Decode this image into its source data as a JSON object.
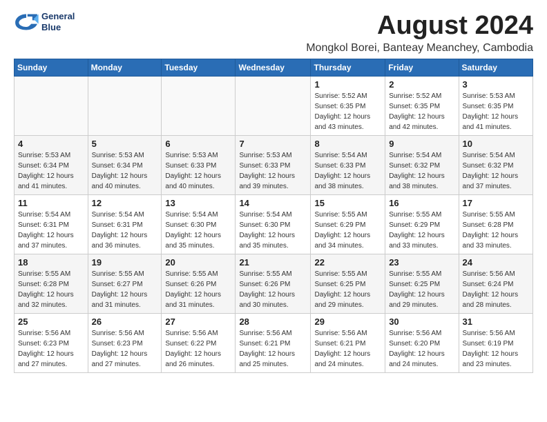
{
  "header": {
    "logo_line1": "General",
    "logo_line2": "Blue",
    "title": "August 2024",
    "subtitle": "Mongkol Borei, Banteay Meanchey, Cambodia"
  },
  "days_of_week": [
    "Sunday",
    "Monday",
    "Tuesday",
    "Wednesday",
    "Thursday",
    "Friday",
    "Saturday"
  ],
  "weeks": [
    [
      {
        "day": "",
        "info": ""
      },
      {
        "day": "",
        "info": ""
      },
      {
        "day": "",
        "info": ""
      },
      {
        "day": "",
        "info": ""
      },
      {
        "day": "1",
        "info": "Sunrise: 5:52 AM\nSunset: 6:35 PM\nDaylight: 12 hours\nand 43 minutes."
      },
      {
        "day": "2",
        "info": "Sunrise: 5:52 AM\nSunset: 6:35 PM\nDaylight: 12 hours\nand 42 minutes."
      },
      {
        "day": "3",
        "info": "Sunrise: 5:53 AM\nSunset: 6:35 PM\nDaylight: 12 hours\nand 41 minutes."
      }
    ],
    [
      {
        "day": "4",
        "info": "Sunrise: 5:53 AM\nSunset: 6:34 PM\nDaylight: 12 hours\nand 41 minutes."
      },
      {
        "day": "5",
        "info": "Sunrise: 5:53 AM\nSunset: 6:34 PM\nDaylight: 12 hours\nand 40 minutes."
      },
      {
        "day": "6",
        "info": "Sunrise: 5:53 AM\nSunset: 6:33 PM\nDaylight: 12 hours\nand 40 minutes."
      },
      {
        "day": "7",
        "info": "Sunrise: 5:53 AM\nSunset: 6:33 PM\nDaylight: 12 hours\nand 39 minutes."
      },
      {
        "day": "8",
        "info": "Sunrise: 5:54 AM\nSunset: 6:33 PM\nDaylight: 12 hours\nand 38 minutes."
      },
      {
        "day": "9",
        "info": "Sunrise: 5:54 AM\nSunset: 6:32 PM\nDaylight: 12 hours\nand 38 minutes."
      },
      {
        "day": "10",
        "info": "Sunrise: 5:54 AM\nSunset: 6:32 PM\nDaylight: 12 hours\nand 37 minutes."
      }
    ],
    [
      {
        "day": "11",
        "info": "Sunrise: 5:54 AM\nSunset: 6:31 PM\nDaylight: 12 hours\nand 37 minutes."
      },
      {
        "day": "12",
        "info": "Sunrise: 5:54 AM\nSunset: 6:31 PM\nDaylight: 12 hours\nand 36 minutes."
      },
      {
        "day": "13",
        "info": "Sunrise: 5:54 AM\nSunset: 6:30 PM\nDaylight: 12 hours\nand 35 minutes."
      },
      {
        "day": "14",
        "info": "Sunrise: 5:54 AM\nSunset: 6:30 PM\nDaylight: 12 hours\nand 35 minutes."
      },
      {
        "day": "15",
        "info": "Sunrise: 5:55 AM\nSunset: 6:29 PM\nDaylight: 12 hours\nand 34 minutes."
      },
      {
        "day": "16",
        "info": "Sunrise: 5:55 AM\nSunset: 6:29 PM\nDaylight: 12 hours\nand 33 minutes."
      },
      {
        "day": "17",
        "info": "Sunrise: 5:55 AM\nSunset: 6:28 PM\nDaylight: 12 hours\nand 33 minutes."
      }
    ],
    [
      {
        "day": "18",
        "info": "Sunrise: 5:55 AM\nSunset: 6:28 PM\nDaylight: 12 hours\nand 32 minutes."
      },
      {
        "day": "19",
        "info": "Sunrise: 5:55 AM\nSunset: 6:27 PM\nDaylight: 12 hours\nand 31 minutes."
      },
      {
        "day": "20",
        "info": "Sunrise: 5:55 AM\nSunset: 6:26 PM\nDaylight: 12 hours\nand 31 minutes."
      },
      {
        "day": "21",
        "info": "Sunrise: 5:55 AM\nSunset: 6:26 PM\nDaylight: 12 hours\nand 30 minutes."
      },
      {
        "day": "22",
        "info": "Sunrise: 5:55 AM\nSunset: 6:25 PM\nDaylight: 12 hours\nand 29 minutes."
      },
      {
        "day": "23",
        "info": "Sunrise: 5:55 AM\nSunset: 6:25 PM\nDaylight: 12 hours\nand 29 minutes."
      },
      {
        "day": "24",
        "info": "Sunrise: 5:56 AM\nSunset: 6:24 PM\nDaylight: 12 hours\nand 28 minutes."
      }
    ],
    [
      {
        "day": "25",
        "info": "Sunrise: 5:56 AM\nSunset: 6:23 PM\nDaylight: 12 hours\nand 27 minutes."
      },
      {
        "day": "26",
        "info": "Sunrise: 5:56 AM\nSunset: 6:23 PM\nDaylight: 12 hours\nand 27 minutes."
      },
      {
        "day": "27",
        "info": "Sunrise: 5:56 AM\nSunset: 6:22 PM\nDaylight: 12 hours\nand 26 minutes."
      },
      {
        "day": "28",
        "info": "Sunrise: 5:56 AM\nSunset: 6:21 PM\nDaylight: 12 hours\nand 25 minutes."
      },
      {
        "day": "29",
        "info": "Sunrise: 5:56 AM\nSunset: 6:21 PM\nDaylight: 12 hours\nand 24 minutes."
      },
      {
        "day": "30",
        "info": "Sunrise: 5:56 AM\nSunset: 6:20 PM\nDaylight: 12 hours\nand 24 minutes."
      },
      {
        "day": "31",
        "info": "Sunrise: 5:56 AM\nSunset: 6:19 PM\nDaylight: 12 hours\nand 23 minutes."
      }
    ]
  ]
}
